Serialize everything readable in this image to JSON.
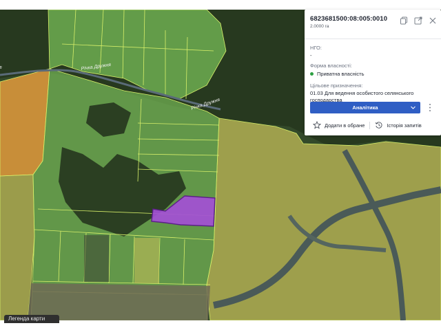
{
  "parcel": {
    "cadastral_number": "6823681500:08:005:0010",
    "area": "2.0000 га",
    "ngo_label": "НГО:",
    "ngo_value": "-",
    "ownership_label": "Форма власності:",
    "ownership_value": "Приватна власність",
    "purpose_label": "Цільове призначення:",
    "purpose_value": "01.03 Для ведення особистого селянського господарства"
  },
  "actions": {
    "analytics_label": "Аналітика",
    "favorite_label": "Додати в обране",
    "history_label": "Історія запитів"
  },
  "map": {
    "river_label_1": "Річка Дружня",
    "river_label_2": "Річка Дружня",
    "river_label_left": "а",
    "legend_label": "Легенда карти"
  },
  "icons": [
    "copy-icon",
    "external-link-icon",
    "close-icon",
    "chevron-down-icon",
    "kebab-menu-icon",
    "star-icon",
    "history-icon"
  ],
  "colors": {
    "private_ownership_dot": "#2ea043",
    "analytics_button": "#2f5ec4",
    "selected_parcel": "#a34fd6",
    "green_parcel": "#7cc25a",
    "yellow_parcel": "#c8c05a",
    "orange_parcel": "#e39a3c",
    "parcel_border": "#d8f06a"
  }
}
